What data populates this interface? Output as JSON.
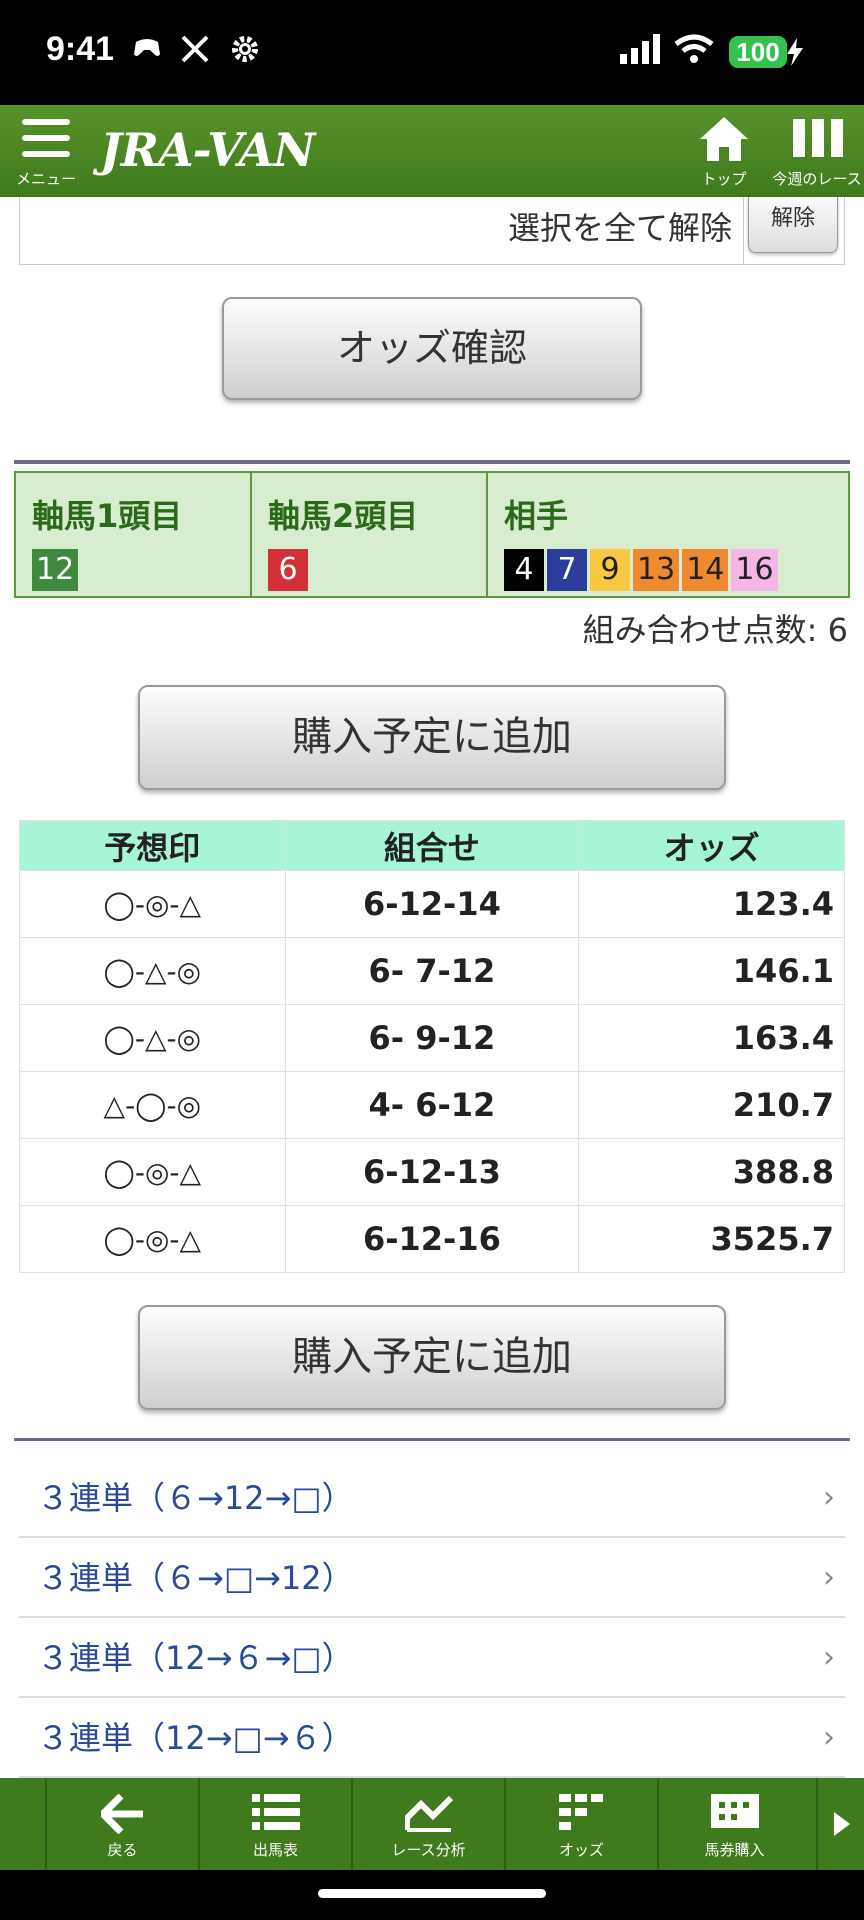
{
  "status": {
    "time": "9:41",
    "battery": "100"
  },
  "header": {
    "logo": "JRA-VAN",
    "menu_label": "メニュー",
    "top_label": "トップ",
    "week_label": "今週のレース"
  },
  "selection": {
    "clear_all": "選択を全て解除",
    "release": "解除"
  },
  "odds_button": "オッズ確認",
  "picks": {
    "col1": {
      "title": "軸馬1頭目",
      "horses": [
        {
          "num": "12",
          "color": "#3f8a3f",
          "text_color": "#ffffff"
        }
      ]
    },
    "col2": {
      "title": "軸馬2頭目",
      "horses": [
        {
          "num": "6",
          "color": "#d4303a",
          "text_color": "#ffffff"
        }
      ]
    },
    "col3": {
      "title": "相手",
      "horses": [
        {
          "num": "4",
          "color": "#000000",
          "text_color": "#ffffff"
        },
        {
          "num": "7",
          "color": "#2c3c9a",
          "text_color": "#ffffff"
        },
        {
          "num": "9",
          "color": "#f7c840",
          "text_color": "#222222"
        },
        {
          "num": "13",
          "color": "#f08a30",
          "text_color": "#222222"
        },
        {
          "num": "14",
          "color": "#f08a30",
          "text_color": "#222222"
        },
        {
          "num": "16",
          "color": "#f4b6e6",
          "text_color": "#222222"
        }
      ]
    }
  },
  "combo_count": "組み合わせ点数: 6",
  "add_button": "購入予定に追加",
  "table": {
    "headers": [
      "予想印",
      "組合せ",
      "オッズ"
    ],
    "rows": [
      {
        "mark": "◯-◎-△",
        "combo": "6-12-14",
        "odds": "123.4"
      },
      {
        "mark": "◯-△-◎",
        "combo": "6- 7-12",
        "odds": "146.1"
      },
      {
        "mark": "◯-△-◎",
        "combo": "6- 9-12",
        "odds": "163.4"
      },
      {
        "mark": "△-◯-◎",
        "combo": "4- 6-12",
        "odds": "210.7"
      },
      {
        "mark": "◯-◎-△",
        "combo": "6-12-13",
        "odds": "388.8"
      },
      {
        "mark": "◯-◎-△",
        "combo": "6-12-16",
        "odds": "3525.7"
      }
    ]
  },
  "links": [
    "３連単（６→12→□）",
    "３連単（６→□→12）",
    "３連単（12→６→□）",
    "３連単（12→□→６）"
  ],
  "bottom_nav": [
    "戻る",
    "出馬表",
    "レース分析",
    "オッズ",
    "馬券購入"
  ]
}
